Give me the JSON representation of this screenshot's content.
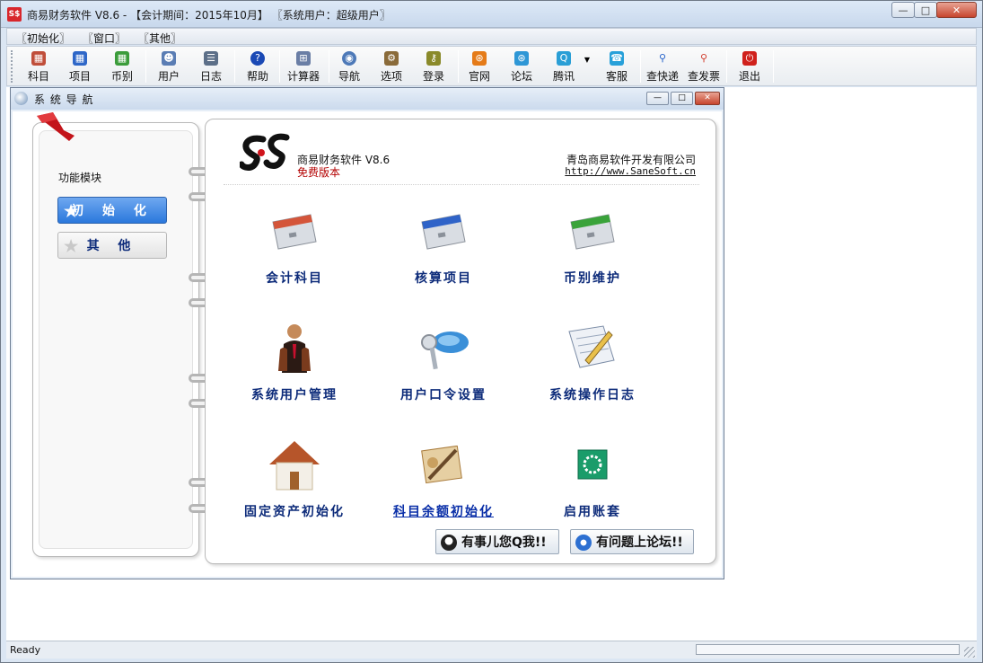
{
  "window": {
    "title": "商易财务软件 V8.6 - 【会计期间：2015年10月】 〖系统用户：超级用户〗",
    "app_icon_text": "S$"
  },
  "menu": [
    "〖初始化〗",
    "〖窗口〗",
    "〖其他〗"
  ],
  "toolbar": [
    {
      "label": "科目",
      "icon": "book-icon",
      "color": "#c04e3a"
    },
    {
      "label": "项目",
      "icon": "folder-icon",
      "color": "#2e67c8"
    },
    {
      "label": "币别",
      "icon": "currency-icon",
      "color": "#3b9c3b"
    },
    {
      "label": "用户",
      "icon": "users-icon",
      "color": "#5a7db4"
    },
    {
      "label": "日志",
      "icon": "log-icon",
      "color": "#5c6f88"
    },
    {
      "label": "帮助",
      "icon": "help-icon",
      "color": "#1a49b5"
    },
    {
      "label": "计算器",
      "icon": "calculator-icon",
      "color": "#6a7ea5"
    },
    {
      "label": "导航",
      "icon": "globe-icon",
      "color": "#4d79b8"
    },
    {
      "label": "选项",
      "icon": "options-icon",
      "color": "#8a6b3a"
    },
    {
      "label": "登录",
      "icon": "key-icon",
      "color": "#8a8a2a"
    },
    {
      "label": "官网",
      "icon": "rss-icon",
      "color": "#e57b18"
    },
    {
      "label": "论坛",
      "icon": "forum-icon",
      "color": "#2e97d6"
    },
    {
      "label": "腾讯",
      "icon": "tencent-icon",
      "color": "#2a9fd6"
    },
    {
      "label": "客服",
      "icon": "service-icon",
      "color": "#27a0d9"
    },
    {
      "label": "查快递",
      "icon": "search-icon",
      "color": "#2360c9"
    },
    {
      "label": "查发票",
      "icon": "search-invoice-icon",
      "color": "#d03a2a"
    },
    {
      "label": "退出",
      "icon": "power-icon",
      "color": "#d0211c"
    }
  ],
  "nav": {
    "title": "系 统 导 航",
    "left": {
      "module_label": "功能模块",
      "buttons": [
        "初 始 化",
        "其 他"
      ]
    },
    "header": {
      "product": "商易财务软件 V8.6",
      "edition": "免费版本",
      "company": "青岛商易软件开发有限公司",
      "url": "http://www.SaneSoft.cn"
    },
    "functions": [
      {
        "label": "会计科目",
        "icon": "account-folder-icon",
        "color": "#d4553a"
      },
      {
        "label": "核算项目",
        "icon": "project-folder-icon",
        "color": "#2f63c8"
      },
      {
        "label": "币别维护",
        "icon": "currency-folder-icon",
        "color": "#3aa33a"
      },
      {
        "label": "系统用户管理",
        "icon": "users-group-icon",
        "color": "#7a3b1d"
      },
      {
        "label": "用户口令设置",
        "icon": "key-icon",
        "color": "#3a8fd8"
      },
      {
        "label": "系统操作日志",
        "icon": "notepad-icon",
        "color": "#7b8ca6"
      },
      {
        "label": "固定资产初始化",
        "icon": "house-icon",
        "color": "#b6552a"
      },
      {
        "label": "科目余额初始化",
        "icon": "tools-icon",
        "color": "#a97b3b"
      },
      {
        "label": "启用账套",
        "icon": "start-icon",
        "color": "#1a9c6a"
      }
    ],
    "bottom_buttons": [
      "有事儿您Q我!!",
      "有问题上论坛!!"
    ]
  },
  "status": {
    "text": "Ready"
  }
}
